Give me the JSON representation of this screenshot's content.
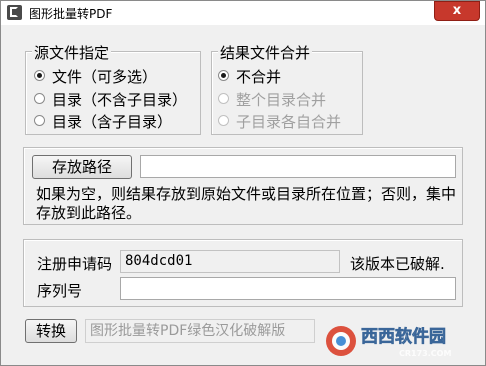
{
  "window": {
    "title": "图形批量转PDF",
    "close_glyph": "x"
  },
  "source_group": {
    "legend": "源文件指定",
    "options": [
      {
        "label": "文件（可多选）",
        "selected": true,
        "enabled": true
      },
      {
        "label": "目录（不含子目录）",
        "selected": false,
        "enabled": true
      },
      {
        "label": "目录（含子目录）",
        "selected": false,
        "enabled": true
      }
    ]
  },
  "merge_group": {
    "legend": "结果文件合并",
    "options": [
      {
        "label": "不合并",
        "selected": true,
        "enabled": true
      },
      {
        "label": "整个目录合并",
        "selected": false,
        "enabled": false
      },
      {
        "label": "子目录各自合并",
        "selected": false,
        "enabled": false
      }
    ]
  },
  "save_path": {
    "button_label": "存放路径",
    "value": "",
    "note": "如果为空，则结果存放到原始文件或目录所在位置；否则，集中存放到此路径。"
  },
  "registration": {
    "reg_code_label": "注册申请码",
    "reg_code_value": "804dcd01",
    "cracked_note": "该版本已破解.",
    "serial_label": "序列号",
    "serial_value": ""
  },
  "bottom": {
    "convert_button": "转换",
    "status_text": "图形批量转PDF绿色汉化破解版"
  },
  "watermark": {
    "brand_text": "西西软件园",
    "sub_text": "CR173.COM"
  }
}
